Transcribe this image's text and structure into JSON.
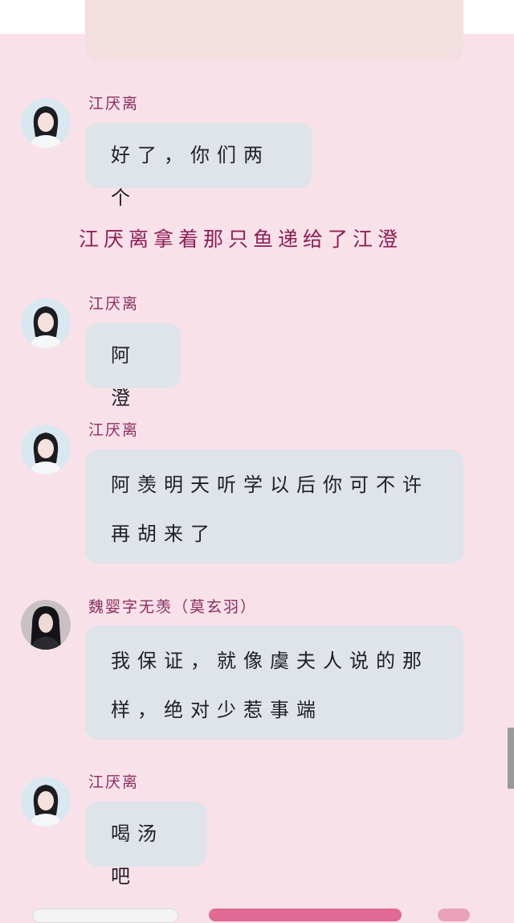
{
  "messages": [
    {
      "sender": "江厌离",
      "text": "好了，你们两个",
      "avatar": "jiang-yanli-avatar"
    },
    {
      "sender": "江厌离",
      "text": "阿澄",
      "avatar": "jiang-yanli-avatar"
    },
    {
      "sender": "江厌离",
      "text": "阿羡明天听学以后你可不许再胡来了",
      "avatar": "jiang-yanli-avatar"
    },
    {
      "sender": "魏婴字无羡（莫玄羽）",
      "text": "我保证，就像虞夫人说的那样，绝对少惹事端",
      "avatar": "wei-ying-avatar"
    },
    {
      "sender": "江厌离",
      "text": "喝汤吧",
      "avatar": "jiang-yanli-avatar"
    }
  ],
  "narration": "江厌离拿着那只鱼递给了江澄",
  "colors": {
    "background": "#f9e1ea",
    "bubble": "#dfe3ea",
    "name": "#8a2f60",
    "narration": "#8d1f55"
  }
}
